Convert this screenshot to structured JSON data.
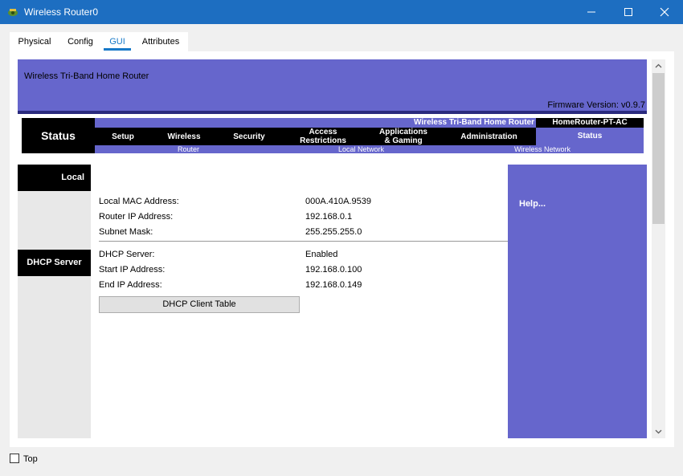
{
  "window": {
    "title": "Wireless Router0"
  },
  "tabs": [
    {
      "label": "Physical"
    },
    {
      "label": "Config"
    },
    {
      "label": "GUI"
    },
    {
      "label": "Attributes"
    }
  ],
  "router": {
    "name": "Wireless Tri-Band Home Router",
    "firmware": "Firmware Version: v0.9.7",
    "nav": {
      "current": "Status",
      "top_label": "Wireless Tri-Band Home Router",
      "model": "HomeRouter-PT-AC",
      "items": [
        {
          "label": "Setup"
        },
        {
          "label": "Wireless"
        },
        {
          "label": "Security"
        },
        {
          "label": "Access\nRestrictions"
        },
        {
          "label": "Applications\n& Gaming"
        },
        {
          "label": "Administration"
        },
        {
          "label": "Status"
        }
      ],
      "subtabs": [
        {
          "label": "Router"
        },
        {
          "label": "Local Network"
        },
        {
          "label": "Wireless Network"
        }
      ]
    },
    "sections": {
      "local": "Local",
      "dhcp": "DHCP Server",
      "help": "Help..."
    },
    "fields": [
      {
        "label": "Local MAC Address:",
        "value": "000A.410A.9539"
      },
      {
        "label": "Router IP Address:",
        "value": "192.168.0.1"
      },
      {
        "label": "Subnet Mask:",
        "value": "255.255.255.0"
      },
      {
        "label": "DHCP Server:",
        "value": "Enabled"
      },
      {
        "label": "Start IP Address:",
        "value": "192.168.0.100"
      },
      {
        "label": "End IP Address:",
        "value": "192.168.0.149"
      }
    ],
    "dhcp_button": "DHCP Client Table"
  },
  "footer": {
    "top_label": "Top"
  },
  "colors": {
    "accent": "#6666cc",
    "titlebar": "#1d6ec1",
    "tab_active": "#1779c8"
  }
}
